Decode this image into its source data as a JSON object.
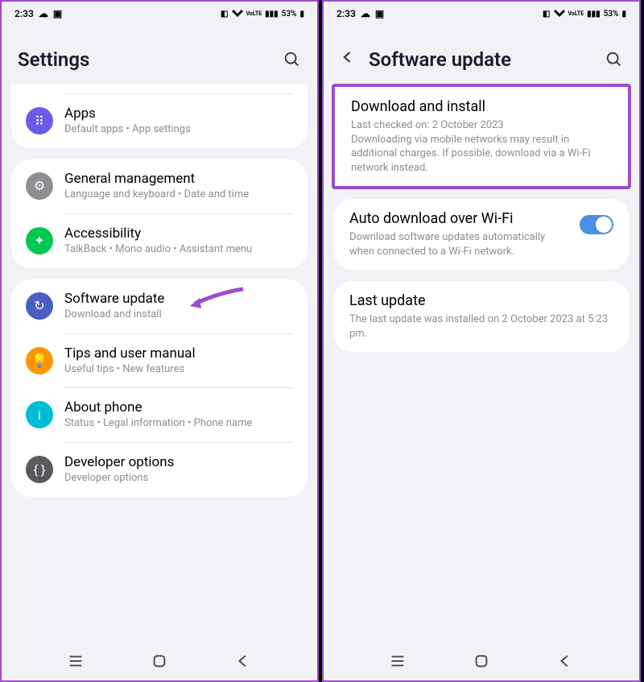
{
  "status": {
    "time": "2:33",
    "battery": "53%",
    "network": "VoLTE"
  },
  "left": {
    "title": "Settings",
    "partial_item": {
      "title": "",
      "subtitle": ""
    },
    "apps": {
      "title": "Apps",
      "subtitle": "Default apps  •  App settings"
    },
    "general": {
      "title": "General management",
      "subtitle": "Language and keyboard  •  Date and time"
    },
    "accessibility": {
      "title": "Accessibility",
      "subtitle": "TalkBack  •  Mono audio  •  Assistant menu"
    },
    "software": {
      "title": "Software update",
      "subtitle": "Download and install"
    },
    "tips": {
      "title": "Tips and user manual",
      "subtitle": "Useful tips  •  New features"
    },
    "about": {
      "title": "About phone",
      "subtitle": "Status  •  Legal information  •  Phone name"
    },
    "developer": {
      "title": "Developer options",
      "subtitle": "Developer options"
    }
  },
  "right": {
    "title": "Software update",
    "download": {
      "title": "Download and install",
      "desc": "Last checked on: 2 October 2023\nDownloading via mobile networks may result in additional charges. If possible, download via a Wi-Fi network instead."
    },
    "auto": {
      "title": "Auto download over Wi-Fi",
      "desc": "Download software updates automatically when connected to a Wi-Fi network."
    },
    "last": {
      "title": "Last update",
      "desc": "The last update was installed on 2 October 2023 at 5:23 pm."
    }
  }
}
